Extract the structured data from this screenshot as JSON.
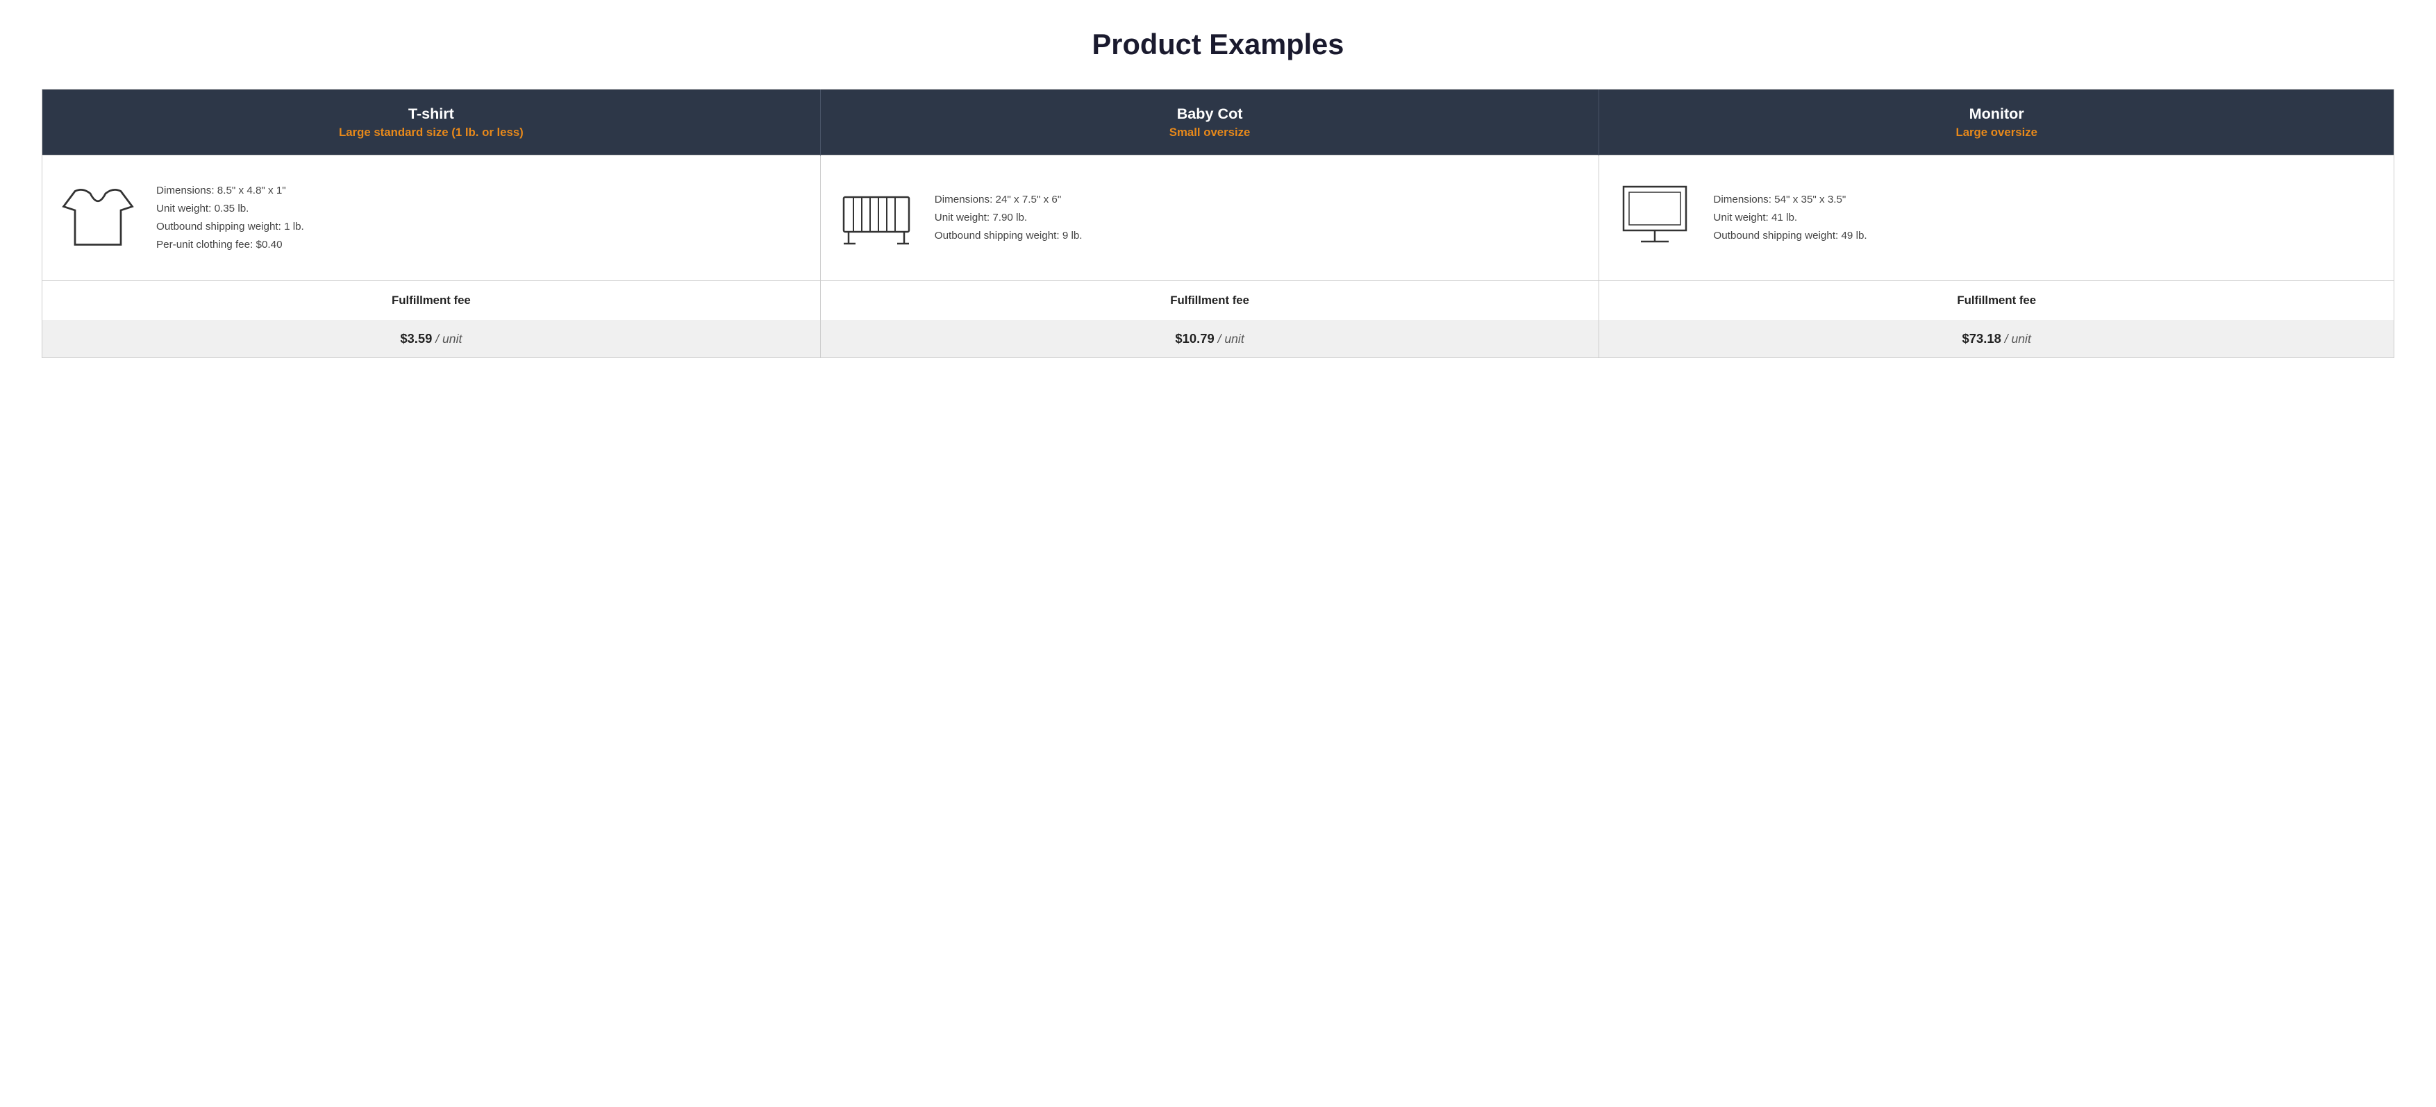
{
  "page": {
    "title": "Product Examples"
  },
  "columns": [
    {
      "id": "tshirt",
      "product_name": "T-shirt",
      "size_label": "Large standard size (1 lb. or less)",
      "icon": "tshirt",
      "dimensions": "Dimensions: 8.5\" x 4.8\" x 1\"",
      "unit_weight": "Unit weight: 0.35 lb.",
      "outbound_shipping_weight": "Outbound shipping weight: 1 lb.",
      "extra_fee": "Per-unit clothing fee: $0.40",
      "fulfillment_label": "Fulfillment fee",
      "fee_amount": "$3.59",
      "fee_unit": "/ unit"
    },
    {
      "id": "baby-cot",
      "product_name": "Baby Cot",
      "size_label": "Small oversize",
      "icon": "cot",
      "dimensions": "Dimensions: 24\" x 7.5\" x 6\"",
      "unit_weight": "Unit weight: 7.90 lb.",
      "outbound_shipping_weight": "Outbound shipping weight: 9 lb.",
      "extra_fee": "",
      "fulfillment_label": "Fulfillment fee",
      "fee_amount": "$10.79",
      "fee_unit": "/ unit"
    },
    {
      "id": "monitor",
      "product_name": "Monitor",
      "size_label": "Large oversize",
      "icon": "monitor",
      "dimensions": "Dimensions: 54\" x 35\" x 3.5\"",
      "unit_weight": "Unit weight: 41 lb.",
      "outbound_shipping_weight": "Outbound shipping weight: 49 lb.",
      "extra_fee": "",
      "fulfillment_label": "Fulfillment fee",
      "fee_amount": "$73.18",
      "fee_unit": "/ unit"
    }
  ]
}
